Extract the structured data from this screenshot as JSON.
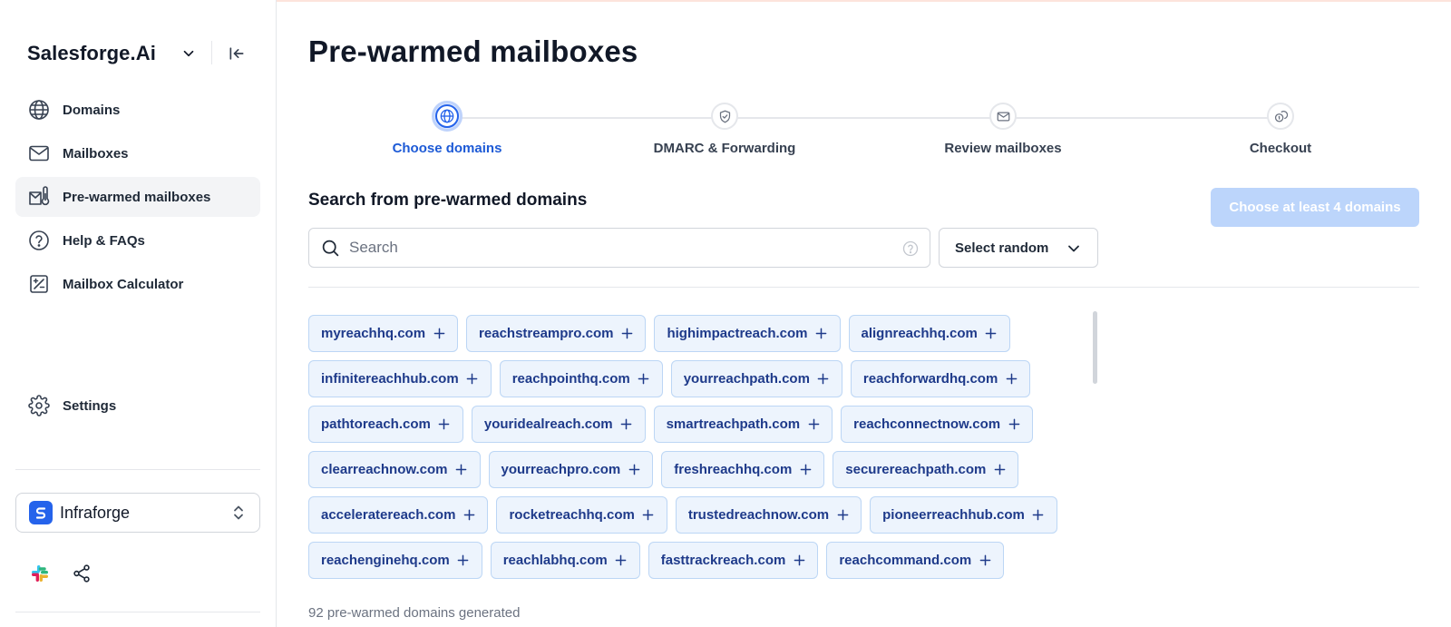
{
  "sidebar": {
    "brand": "Salesforge.Ai",
    "nav": [
      {
        "label": "Domains",
        "icon": "globe-icon",
        "active": false
      },
      {
        "label": "Mailboxes",
        "icon": "mail-icon",
        "active": false
      },
      {
        "label": "Pre-warmed mailboxes",
        "icon": "warm-mailbox-icon",
        "active": true
      },
      {
        "label": "Help & FAQs",
        "icon": "help-circle-icon",
        "active": false
      },
      {
        "label": "Mailbox Calculator",
        "icon": "calculator-icon",
        "active": false
      }
    ],
    "settings_label": "Settings",
    "workspace": {
      "name": "Infraforge",
      "accent": "#2563eb"
    }
  },
  "main": {
    "title": "Pre-warmed mailboxes",
    "steps": [
      {
        "label": "Choose domains",
        "icon": "globe-icon",
        "active": true
      },
      {
        "label": "DMARC & Forwarding",
        "icon": "shield-check-icon",
        "active": false
      },
      {
        "label": "Review mailboxes",
        "icon": "mail-icon",
        "active": false
      },
      {
        "label": "Checkout",
        "icon": "coins-icon",
        "active": false
      }
    ],
    "section_title": "Search from pre-warmed domains",
    "cta_label": "Choose at least 4 domains",
    "search": {
      "placeholder": "Search",
      "value": ""
    },
    "select_random_label": "Select random",
    "domains": [
      "myreachhq.com",
      "reachstreampro.com",
      "highimpactreach.com",
      "alignreachhq.com",
      "infinitereachhub.com",
      "reachpointhq.com",
      "yourreachpath.com",
      "reachforwardhq.com",
      "pathtoreach.com",
      "youridealreach.com",
      "smartreachpath.com",
      "reachconnectnow.com",
      "clearreachnow.com",
      "yourreachpro.com",
      "freshreachhq.com",
      "securereachpath.com",
      "acceleratereach.com",
      "rocketreachhq.com",
      "trustedreachnow.com",
      "pioneerreachhub.com",
      "reachenginehq.com",
      "reachlabhq.com",
      "fasttrackreach.com",
      "reachcommand.com"
    ],
    "footer_count": "92 pre-warmed domains generated"
  },
  "colors": {
    "accent": "#2563eb",
    "chip_bg": "#edf4fd",
    "chip_border": "#bcd6f5",
    "chip_text": "#1e3a8a",
    "cta_disabled": "#bcd5fb"
  }
}
